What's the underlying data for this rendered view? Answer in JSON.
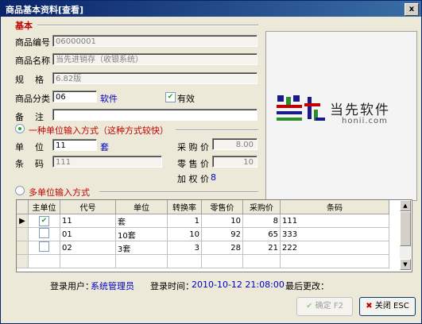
{
  "window": {
    "title": "商品基本资料[查看]",
    "close_label": "x"
  },
  "section_basic": "基本",
  "fields": {
    "code_label": "商品编号",
    "code_value": "06000001",
    "name_label": "商品名称",
    "name_value": "当先进销存（收银系统）",
    "spec_label": "规    格",
    "spec_value": "6.82版",
    "category_label": "商品分类",
    "category_value": "06",
    "category_name": "软件",
    "valid_label": "有效",
    "valid_checked": true,
    "remark_label": "备    注",
    "remark_value": ""
  },
  "logo": {
    "cn_text": "当先软件",
    "url_text": "honii.com"
  },
  "single_unit": {
    "radio_label": "一种单位输入方式（这种方式较快）",
    "unit_label": "单    位",
    "unit_value": "11",
    "unit_name": "套",
    "barcode_label": "条    码",
    "barcode_value": "111",
    "purchase_label": "采 购 价",
    "purchase_value": "8.00",
    "retail_label": "零 售 价",
    "retail_value": "10",
    "weighted_label": "加 权 价",
    "weighted_value": "8"
  },
  "multi_unit": {
    "radio_label": "多单位输入方式",
    "columns": [
      "主单位",
      "代号",
      "单位",
      "转换率",
      "零售价",
      "采购价",
      "条码"
    ],
    "rows": [
      {
        "main": true,
        "code": "11",
        "unit": "套",
        "rate": "1",
        "retail": "10",
        "purchase": "8",
        "barcode": "111"
      },
      {
        "main": false,
        "code": "01",
        "unit": "10套",
        "rate": "10",
        "retail": "92",
        "purchase": "65",
        "barcode": "333"
      },
      {
        "main": false,
        "code": "02",
        "unit": "3套",
        "rate": "3",
        "retail": "28",
        "purchase": "21",
        "barcode": "222"
      }
    ]
  },
  "status": {
    "user_label": "登录用户：",
    "user_value": "系统管理员",
    "time_label": "登录时间：",
    "time_value": "2010-10-12 21:08:00",
    "last_change_label": "最后更改："
  },
  "buttons": {
    "ok_label": "确定 F2",
    "close_label": "关闭 ESC"
  }
}
